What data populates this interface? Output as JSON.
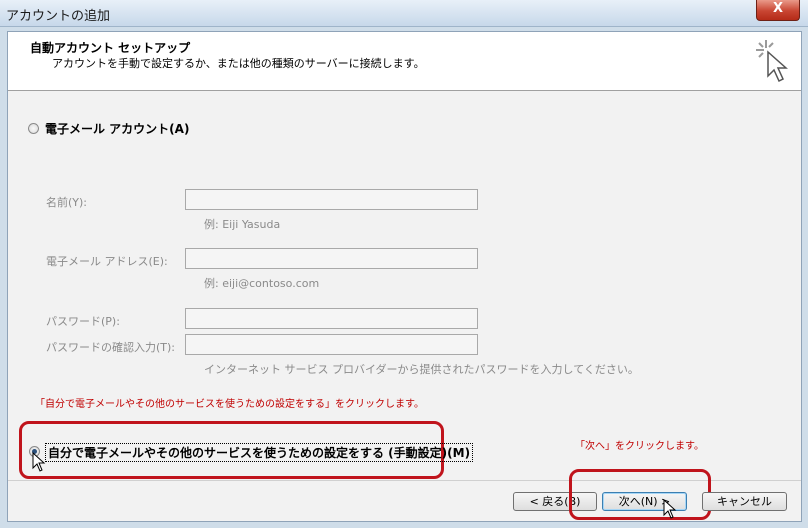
{
  "window": {
    "title": "アカウントの追加",
    "close_label": "X"
  },
  "header": {
    "title": "自動アカウント セットアップ",
    "subtitle": "アカウントを手動で設定するか、または他の種類のサーバーに接続します。"
  },
  "options": {
    "email_account_label": "電子メール アカウント(A)",
    "manual_setup_label": "自分で電子メールやその他のサービスを使うための設定をする (手動設定)(M)"
  },
  "form": {
    "name_label": "名前(Y):",
    "name_hint": "例: Eiji Yasuda",
    "email_label": "電子メール アドレス(E):",
    "email_hint": "例: eiji@contoso.com",
    "password_label": "パスワード(P):",
    "password_confirm_label": "パスワードの確認入力(T):",
    "password_hint": "インターネット サービス プロバイダーから提供されたパスワードを入力してください。"
  },
  "annotations": {
    "manual_instruction": "「自分で電子メールやその他のサービスを使うための設定をする」をクリックします。",
    "next_instruction": "「次へ」をクリックします。"
  },
  "buttons": {
    "back": "< 戻る(B)",
    "next": "次へ(N) >",
    "cancel": "キャンセル"
  },
  "colors": {
    "annotation_red": "#c00000",
    "highlight_red": "#c0141c"
  }
}
